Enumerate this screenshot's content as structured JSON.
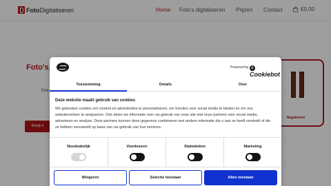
{
  "header": {
    "logo": {
      "brand_bold": "Foto",
      "brand_rest": "Digitaliseren"
    },
    "nav": [
      {
        "label": "Home",
        "active": true
      },
      {
        "label": "Foto's digitaliseren",
        "active": false
      },
      {
        "label": "Prijzen",
        "active": false
      },
      {
        "label": "Contact",
        "active": false
      }
    ],
    "cart": {
      "icon": "shopping-bag-icon",
      "amount": "€0,00"
    }
  },
  "hero": {
    "title_fragment": "Foto's,",
    "text_fragment": "Ene",
    "button_fragment": "Bekijk h",
    "product_label": "Negatieven"
  },
  "cookie_dialog": {
    "logo_icon": "cookiebot-logo-icon",
    "powered_by": "Powered by",
    "cookiebot": "Cookiebot",
    "tabs": [
      {
        "label": "Toestemming",
        "active": true
      },
      {
        "label": "Details",
        "active": false
      },
      {
        "label": "Over",
        "active": false
      }
    ],
    "title": "Deze website maakt gebruik van cookies",
    "body": "We gebruiken cookies om content en advertenties te personaliseren, om functies voor social media te bieden en om ons websiteverkeer te analyseren. Ook delen we informatie over uw gebruik van onze site met onze partners voor social media, adverteren en analyse. Deze partners kunnen deze gegevens combineren met andere informatie die u aan ze heeft verstrekt of die ze hebben verzameld op basis van uw gebruik van hun services.",
    "preferences": [
      {
        "label": "Noodzakelijk",
        "state": "on-disabled"
      },
      {
        "label": "Voorkeuren",
        "state": "off"
      },
      {
        "label": "Statistieken",
        "state": "off"
      },
      {
        "label": "Marketing",
        "state": "off"
      }
    ],
    "buttons": {
      "reject": "Weigeren",
      "selection": "Selectie toestaan",
      "accept_all": "Alles toestaan"
    }
  },
  "colors": {
    "brand": "#b0161b",
    "accent": "#1032cf"
  }
}
